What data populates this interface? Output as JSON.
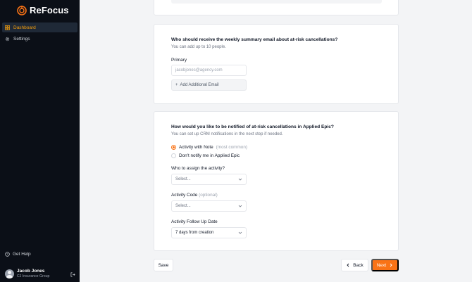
{
  "app": {
    "name": "ReFocus"
  },
  "sidebar": {
    "items": [
      {
        "label": "Dashboard",
        "icon": "grid-icon",
        "active": true
      },
      {
        "label": "Settings",
        "icon": "gear-icon",
        "active": false
      }
    ],
    "help_label": "Get Help",
    "user": {
      "name": "Jacob Jones",
      "org": "CJ Insurance Group"
    }
  },
  "email_section": {
    "question": "Who should receive the weekly summary email about at-risk cancellations?",
    "subtext": "You can add up to 10 people.",
    "primary_label": "Primary",
    "primary_placeholder": "jacobjones@agency.com",
    "add_label": "Add Additional Email"
  },
  "notify_section": {
    "question": "How would you like to be notified of at-risk cancellations in Applied Epic?",
    "subtext": "You can set up CRM notifications in the next step if needed.",
    "options": [
      {
        "label": "Activity with Note",
        "note": "(most common)",
        "selected": true
      },
      {
        "label": "Don't notify me in Applied Epic",
        "note": "",
        "selected": false
      }
    ],
    "assign_label": "Who to assign the activity?",
    "assign_value": "Select...",
    "code_label": "Activity Code",
    "code_optional": "(optional)",
    "code_value": "Select...",
    "followup_label": "Activity Follow Up Date",
    "followup_value": "7 days from creation"
  },
  "actions": {
    "save": "Save",
    "back": "Back",
    "next": "Next"
  },
  "colors": {
    "accent": "#f97316",
    "sidebar_bg": "#0b0f17",
    "active_text": "#f59e0b"
  }
}
